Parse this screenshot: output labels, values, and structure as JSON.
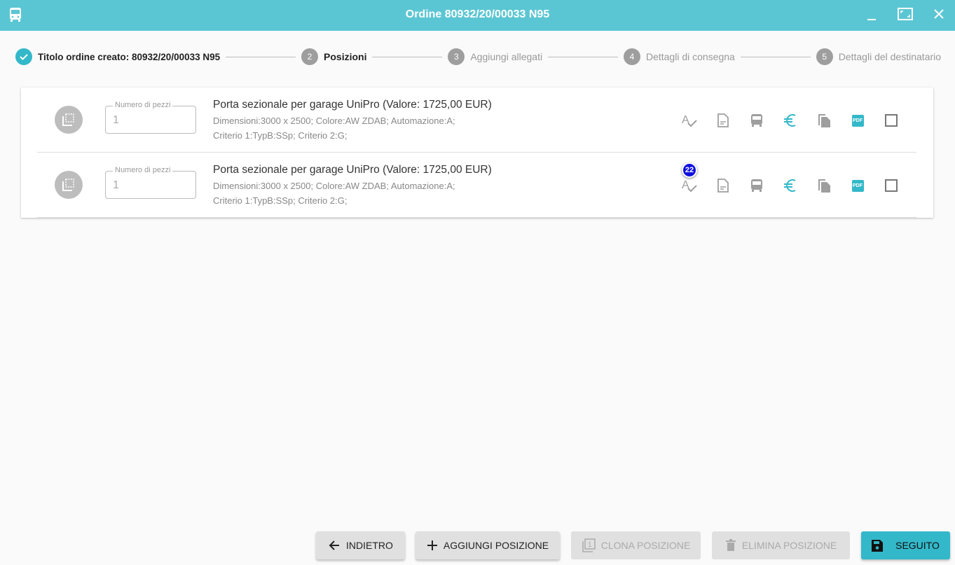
{
  "window": {
    "title": "Ordine 80932/20/00033 N95"
  },
  "stepper": [
    {
      "num": "✓",
      "label": "Titolo ordine creato: 80932/20/00033 N95"
    },
    {
      "num": "2",
      "label": "Posizioni"
    },
    {
      "num": "3",
      "label": "Aggiungi allegati"
    },
    {
      "num": "4",
      "label": "Dettagli di consegna"
    },
    {
      "num": "5",
      "label": "Dettagli del destinatario"
    }
  ],
  "positions": [
    {
      "qty_label": "Numero di pezzi",
      "qty": "1",
      "title": "Porta sezionale per garage UniPro (Valore: 1725,00 EUR)",
      "details1": "Dimensioni:3000 x 2500; Colore:AW ZDAB; Automazione:A;",
      "details2": "Criterio 1:TypB:SSp; Criterio 2:G;"
    },
    {
      "qty_label": "Numero di pezzi",
      "qty": "1",
      "title": "Porta sezionale per garage UniPro (Valore: 1725,00 EUR)",
      "details1": "Dimensioni:3000 x 2500; Colore:AW ZDAB; Automazione:A;",
      "details2": "Criterio 1:TypB:SSp; Criterio 2:G;",
      "badge": "22"
    }
  ],
  "pdf_label": "PDF",
  "buttons": {
    "back": "INDIETRO",
    "add": "AGGIUNGI POSIZIONE",
    "clone": "CLONA POSIZIONE",
    "delete": "ELIMINA POSIZIONE",
    "next": "SEGUITO"
  },
  "colors": {
    "accent": "#33b8c9",
    "header": "#5bc6d3",
    "badge": "#1010e0"
  }
}
